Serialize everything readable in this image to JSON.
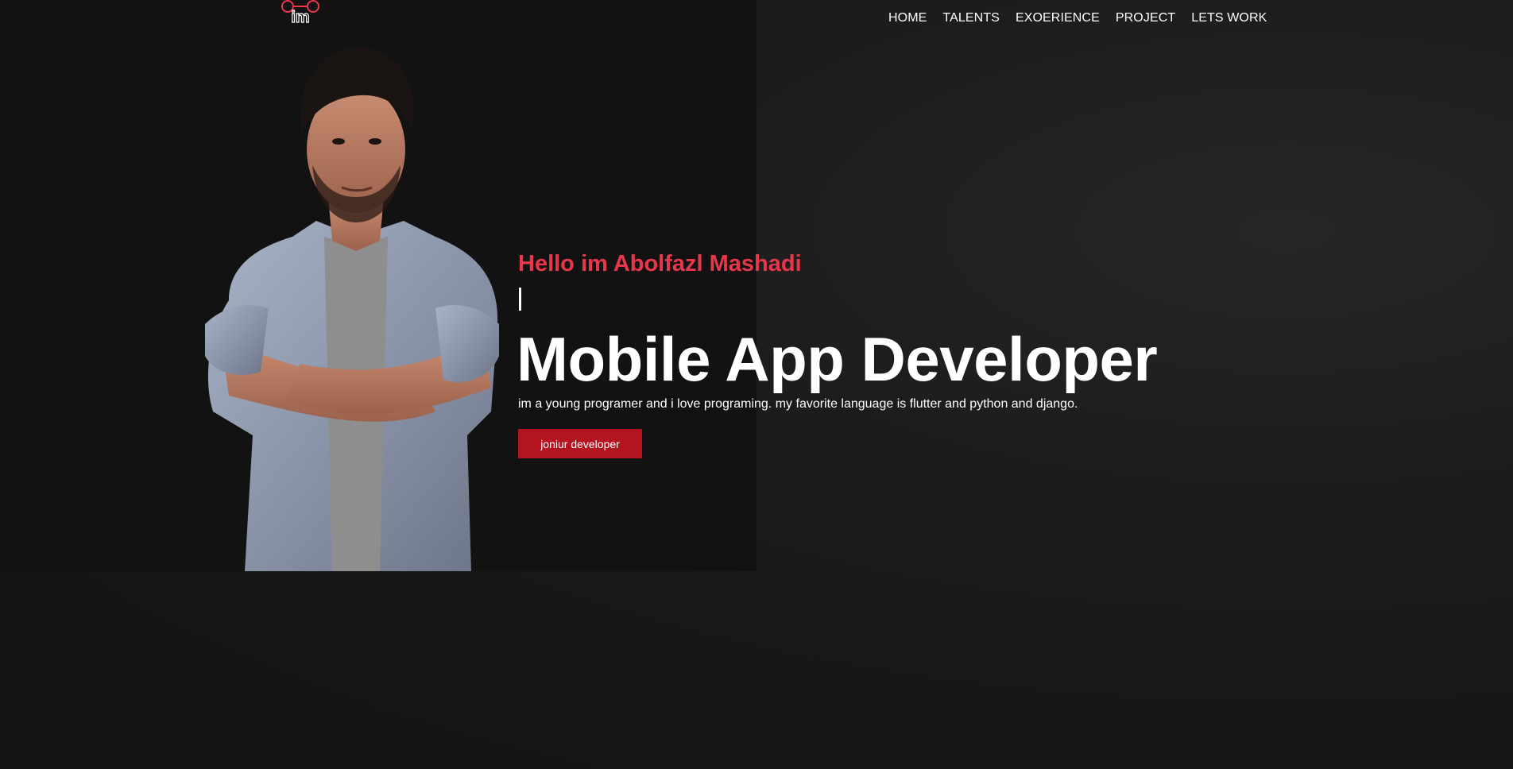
{
  "logo": {
    "text": "im",
    "icon": "im-logo-icon",
    "accent_color": "#e8364a"
  },
  "nav": {
    "items": [
      {
        "label": "HOME"
      },
      {
        "label": "TALENTS"
      },
      {
        "label": "EXOERIENCE"
      },
      {
        "label": "PROJECT"
      },
      {
        "label": "LETS WORK"
      }
    ]
  },
  "hero": {
    "greeting": "Hello im Abolfazl Mashadi",
    "headline": "Mobile App Developer",
    "description": "im a young programer and i love programing. my favorite language is flutter and python and django.",
    "cta_label": "joniur developer",
    "portrait": "portrait-photo"
  },
  "colors": {
    "accent": "#e8364a",
    "button": "#b3141f",
    "background": "#171717",
    "text": "#ffffff"
  }
}
